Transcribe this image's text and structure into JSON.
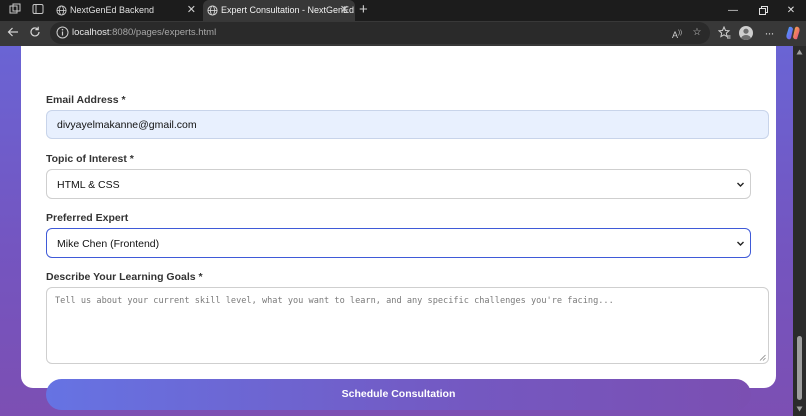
{
  "browser": {
    "tabs": [
      {
        "title": "NextGenEd Backend",
        "active": false
      },
      {
        "title": "Expert Consultation - NextGenEd",
        "active": true
      }
    ],
    "url_host": "localhost",
    "url_rest": ":8080/pages/experts.html",
    "icons": [
      "workspaces-icon",
      "tab-actions-icon",
      "globe-icon",
      "close-icon",
      "new-tab-icon",
      "minimize-icon",
      "restore-icon",
      "close-window-icon",
      "back-icon",
      "refresh-icon",
      "info-icon",
      "read-aloud-icon",
      "favorite-icon",
      "favorites-icon",
      "profile-avatar",
      "more-icon",
      "copilot-icon"
    ]
  },
  "form": {
    "email_label": "Email Address *",
    "email_value": "divyayelmakanne@gmail.com",
    "topic_label": "Topic of Interest *",
    "topic_value": "HTML & CSS",
    "expert_label": "Preferred Expert",
    "expert_value": "Mike Chen (Frontend)",
    "goals_label": "Describe Your Learning Goals *",
    "goals_placeholder": "Tell us about your current skill level, what you want to learn, and any specific challenges you're facing...",
    "submit_label": "Schedule Consultation"
  },
  "colors": {
    "accent": "#3f5ad8",
    "gradient_start": "#6a64d4",
    "gradient_end": "#7c4fb3",
    "autofill_bg": "#e8f0fe"
  }
}
